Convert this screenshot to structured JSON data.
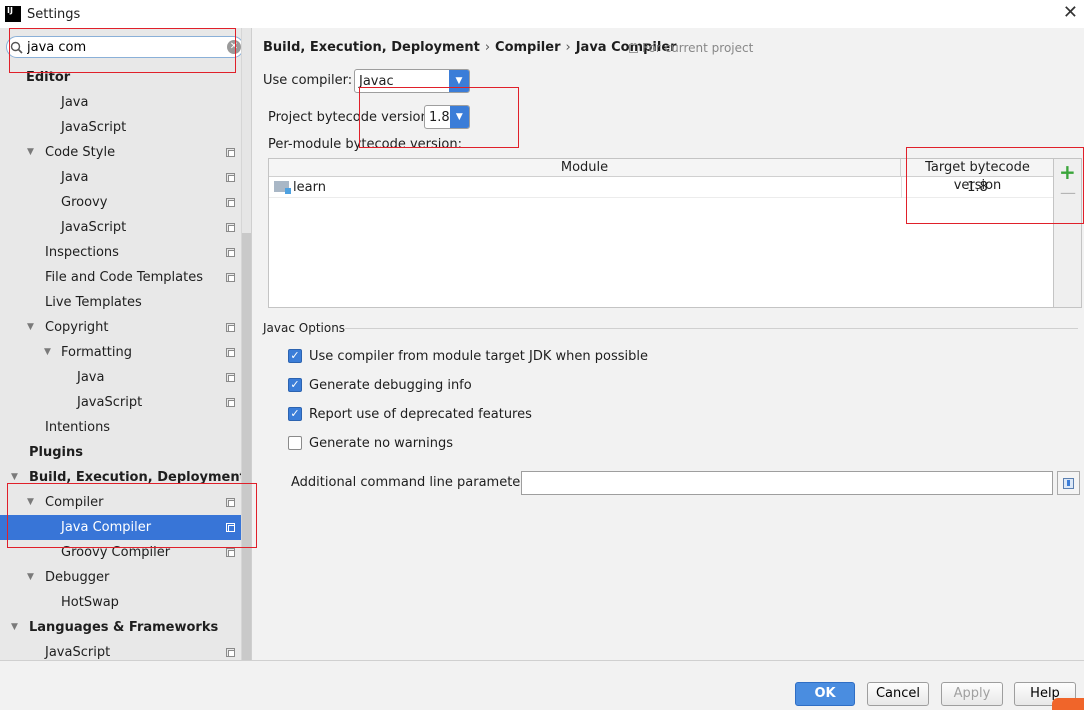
{
  "window": {
    "title": "Settings",
    "app_icon": "IJ"
  },
  "search": {
    "value": "java com"
  },
  "sidebar": {
    "items": [
      {
        "label": "Editor",
        "level": 0,
        "bold": true,
        "arrow": "",
        "copy": false
      },
      {
        "label": "Java",
        "level": 2,
        "bold": false,
        "arrow": "",
        "copy": false
      },
      {
        "label": "JavaScript",
        "level": 2,
        "bold": false,
        "arrow": "",
        "copy": false
      },
      {
        "label": "Code Style",
        "level": 1,
        "bold": false,
        "arrow": "▼",
        "copy": true
      },
      {
        "label": "Java",
        "level": 2,
        "bold": false,
        "arrow": "",
        "copy": true
      },
      {
        "label": "Groovy",
        "level": 2,
        "bold": false,
        "arrow": "",
        "copy": true
      },
      {
        "label": "JavaScript",
        "level": 2,
        "bold": false,
        "arrow": "",
        "copy": true
      },
      {
        "label": "Inspections",
        "level": 1,
        "bold": false,
        "arrow": "",
        "copy": true
      },
      {
        "label": "File and Code Templates",
        "level": 1,
        "bold": false,
        "arrow": "",
        "copy": true
      },
      {
        "label": "Live Templates",
        "level": 1,
        "bold": false,
        "arrow": "",
        "copy": false
      },
      {
        "label": "Copyright",
        "level": 1,
        "bold": false,
        "arrow": "▼",
        "copy": true
      },
      {
        "label": "Formatting",
        "level": 2,
        "bold": false,
        "arrow": "▼",
        "copy": true
      },
      {
        "label": "Java",
        "level": 3,
        "bold": false,
        "arrow": "",
        "copy": true
      },
      {
        "label": "JavaScript",
        "level": 3,
        "bold": false,
        "arrow": "",
        "copy": true
      },
      {
        "label": "Intentions",
        "level": 1,
        "bold": false,
        "arrow": "",
        "copy": false
      },
      {
        "label": "Plugins",
        "level": 0,
        "bold": true,
        "arrow": "",
        "copy": false
      },
      {
        "label": "Build, Execution, Deployment",
        "level": 0,
        "bold": true,
        "arrow": "▼",
        "copy": false
      },
      {
        "label": "Compiler",
        "level": 1,
        "bold": false,
        "arrow": "▼",
        "copy": true
      },
      {
        "label": "Java Compiler",
        "level": 2,
        "bold": false,
        "arrow": "",
        "copy": true,
        "selected": true
      },
      {
        "label": "Groovy Compiler",
        "level": 2,
        "bold": false,
        "arrow": "",
        "copy": true
      },
      {
        "label": "Debugger",
        "level": 1,
        "bold": false,
        "arrow": "▼",
        "copy": false
      },
      {
        "label": "HotSwap",
        "level": 2,
        "bold": false,
        "arrow": "",
        "copy": false
      },
      {
        "label": "Languages & Frameworks",
        "level": 0,
        "bold": true,
        "arrow": "▼",
        "copy": false
      },
      {
        "label": "JavaScript",
        "level": 1,
        "bold": false,
        "arrow": "",
        "copy": true
      }
    ]
  },
  "breadcrumb": {
    "parts": [
      "Build, Execution, Deployment",
      "Compiler",
      "Java Compiler"
    ],
    "separator": "›",
    "scope": "For current project"
  },
  "compiler": {
    "use_compiler_label": "Use compiler:",
    "use_compiler_value": "Javac",
    "bytecode_label": "Project bytecode version:",
    "bytecode_value": "1.8",
    "per_module_label": "Per-module bytecode version:"
  },
  "table": {
    "columns": [
      "Module",
      "Target bytecode version"
    ],
    "rows": [
      {
        "module": "learn",
        "target": "1.8"
      }
    ],
    "add_symbol": "+",
    "remove_symbol": "—"
  },
  "javac_options": {
    "title": "Javac Options",
    "checkboxes": [
      {
        "label": "Use compiler from module target JDK when possible",
        "checked": true
      },
      {
        "label": "Generate debugging info",
        "checked": true
      },
      {
        "label": "Report use of deprecated features",
        "checked": true
      },
      {
        "label": "Generate no warnings",
        "checked": false
      }
    ],
    "additional_label": "Additional command line parameters:",
    "additional_value": ""
  },
  "footer": {
    "ok": "OK",
    "cancel": "Cancel",
    "apply": "Apply",
    "help": "Help"
  },
  "colors": {
    "accent": "#3b7dd8",
    "selection": "#3875d7",
    "highlight_box": "#e0202a",
    "add": "#3aa53a"
  },
  "icons": {
    "search": "search-icon",
    "clear": "clear-icon",
    "close": "close-icon",
    "copy": "project-scope-icon",
    "folder": "module-folder-icon",
    "expand": "expand-icon"
  }
}
